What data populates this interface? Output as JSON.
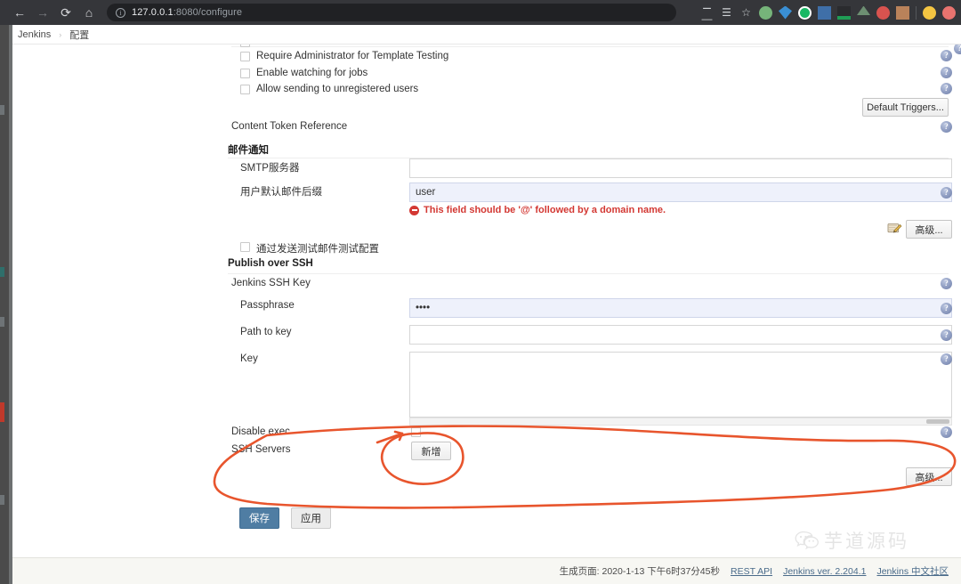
{
  "browser": {
    "url": "127.0.0.1:8080/configure",
    "url_host": "127.0.0.1",
    "url_rest": ":8080/configure",
    "back_icon": "←",
    "forward_icon": "→",
    "reload_icon": "⟳",
    "home_icon": "⌂",
    "info_icon": "i"
  },
  "breadcrumb": {
    "root": "Jenkins",
    "separator": "›",
    "current": "配置"
  },
  "form": {
    "checkboxes": [
      {
        "label": "Require Administrator for Template Testing"
      },
      {
        "label": "Enable watching for jobs"
      },
      {
        "label": "Allow sending to unregistered users"
      }
    ],
    "default_triggers_button": "Default Triggers...",
    "content_token_reference": "Content Token Reference",
    "email_section": {
      "title": "邮件通知",
      "smtp_label": "SMTP服务器",
      "smtp_value": "",
      "suffix_label": "用户默认邮件后缀",
      "suffix_value": "user",
      "error_message": "This field should be '@' followed by a domain name.",
      "advanced_button": "高级...",
      "test_checkbox_label": "通过发送测试邮件测试配置"
    },
    "ssh_section": {
      "title": "Publish over SSH",
      "jenkins_ssh_key_label": "Jenkins SSH Key",
      "passphrase_label": "Passphrase",
      "passphrase_value": "••••",
      "path_to_key_label": "Path to key",
      "path_to_key_value": "",
      "key_label": "Key",
      "key_value": "",
      "disable_exec_label": "Disable exec",
      "ssh_servers_label": "SSH Servers",
      "add_button": "新增",
      "advanced_button": "高级..."
    },
    "save_button": "保存",
    "apply_button": "应用",
    "help_icon": "?"
  },
  "footer": {
    "generated_text": "生成页面: 2020-1-13 下午6时37分45秒",
    "links": [
      "REST API",
      "Jenkins ver. 2.204.1",
      "Jenkins 中文社区"
    ]
  },
  "watermark": {
    "text": "芋道源码"
  },
  "colors": {
    "accent": "#4f7da3",
    "error": "#d33833",
    "annotation": "#e8552d",
    "browser_chrome": "#35363a",
    "omnibox": "#202124"
  }
}
